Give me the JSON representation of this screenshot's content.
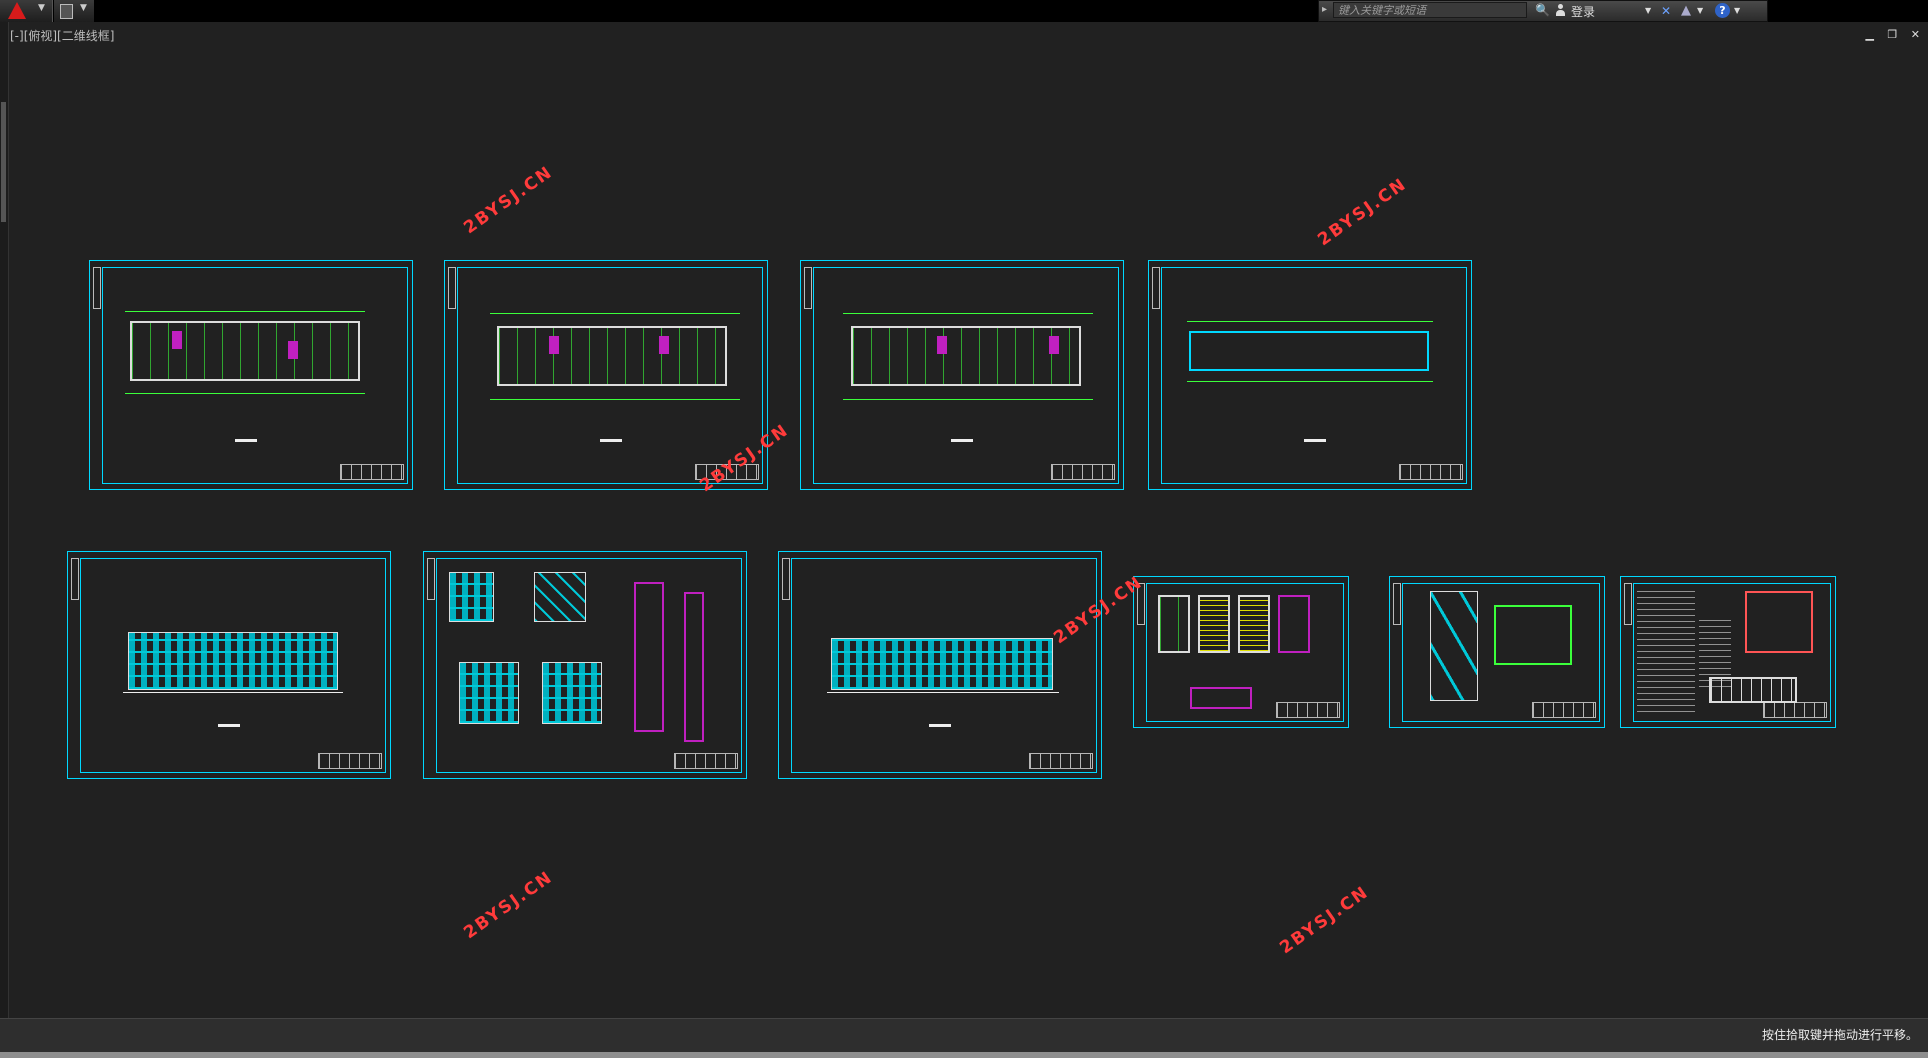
{
  "search": {
    "placeholder": "键入关键字或短语"
  },
  "infocenter": {
    "login_label": "登录"
  },
  "viewport": {
    "controls_label": "[-][俯视][二维线框]"
  },
  "watermark": {
    "text": "2BYSJ.CN"
  },
  "status": {
    "message": "按住拾取键并拖动进行平移。"
  },
  "icons": {
    "app": "autocad-logo-icon",
    "save": "save-icon",
    "search": "binoculars-icon",
    "user": "user-icon",
    "exchange": "exchange-icon",
    "autodesk": "autodesk-icon",
    "help": "help-icon"
  },
  "colors": {
    "background": "#212121",
    "sheet_border": "#00d8ff",
    "plan_lines": "#3bff3b",
    "watermark": "#ff3b3b"
  }
}
